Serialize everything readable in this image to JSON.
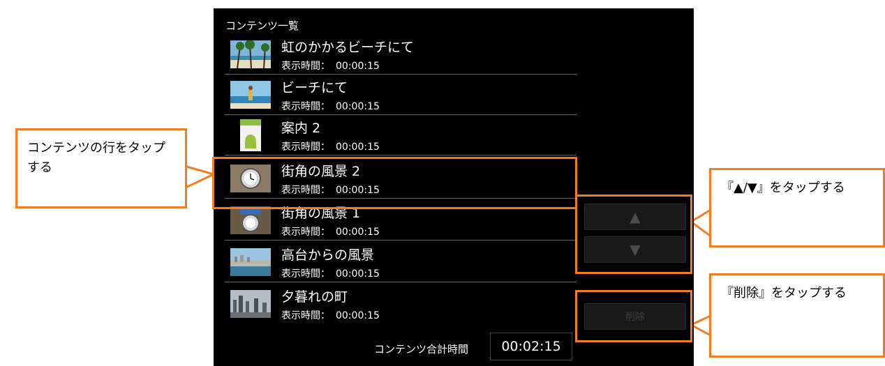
{
  "list": {
    "title": "コンテンツ一覧",
    "time_label": "表示時間：",
    "items": [
      {
        "title": "虹のかかるビーチにて",
        "time": "00:00:15",
        "thumb": "beach-palms"
      },
      {
        "title": "ビーチにて",
        "time": "00:00:15",
        "thumb": "beach-surfer"
      },
      {
        "title": "案内 2",
        "time": "00:00:15",
        "thumb": "android-mascot"
      },
      {
        "title": "街角の風景 2",
        "time": "00:00:15",
        "thumb": "street-clock"
      },
      {
        "title": "街角の風景 1",
        "time": "00:00:15",
        "thumb": "street-clock"
      },
      {
        "title": "高台からの風景",
        "time": "00:00:15",
        "thumb": "city-coast"
      },
      {
        "title": "夕暮れの町",
        "time": "00:00:15",
        "thumb": "city-dusk"
      }
    ]
  },
  "controls": {
    "up_label": "▲",
    "down_label": "▼",
    "delete_label": "削除"
  },
  "footer": {
    "total_label": "コンテンツ合計時間",
    "total_time": "00:02:15"
  },
  "callouts": {
    "row": "コンテンツの行をタップする",
    "arrows": "『▲/▼』をタップする",
    "delete": "『削除』をタップする"
  },
  "colors": {
    "accent": "#f27d21",
    "screen_bg": "#000000"
  }
}
